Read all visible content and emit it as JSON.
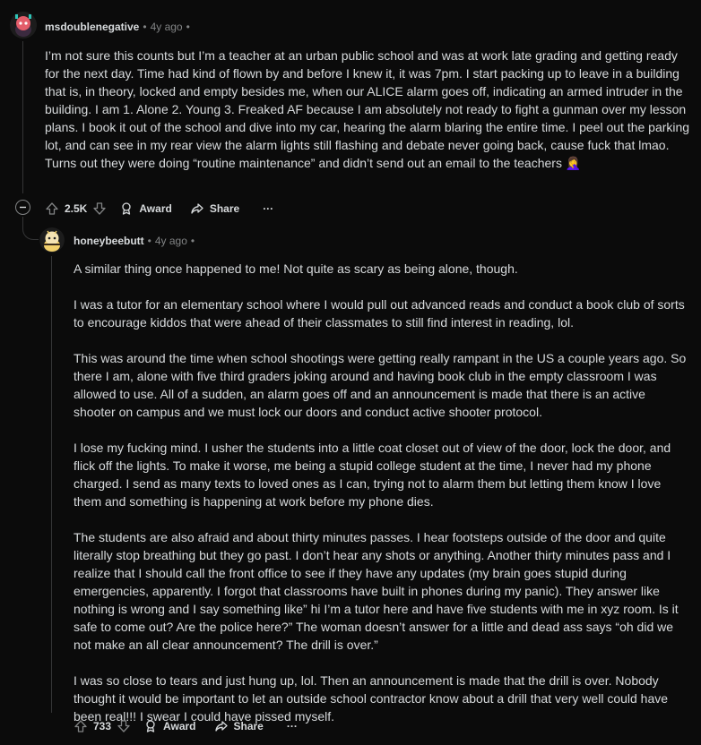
{
  "comments": [
    {
      "author": "msdoublenegative",
      "time": "4y ago",
      "body": [
        "I’m not sure this counts but I’m a teacher at an urban public school and was at work late grading and getting ready for the next day. Time had kind of flown by and before I knew it, it was 7pm. I start packing up to leave in a building that is, in theory, locked and empty besides me, when our ALICE alarm goes off, indicating an armed intruder in the building. I am 1. Alone 2. Young 3. Freaked AF because I am absolutely not ready to fight a gunman over my lesson plans. I book it out of the school and dive into my car, hearing the alarm blaring the entire time. I peel out the parking lot, and can see in my rear view the alarm lights still flashing and debate never going back, cause fuck that lmao. Turns out they were doing “routine maintenance” and didn’t send out an email to the teachers 🤦‍♀️"
      ],
      "votes": "2.5K",
      "award_label": "Award",
      "share_label": "Share",
      "more_label": "···"
    },
    {
      "author": "honeybeebutt",
      "time": "4y ago",
      "body": [
        "A similar thing once happened to me! Not quite as scary as being alone, though.",
        "I was a tutor for an elementary school where I would pull out advanced reads and conduct a book club of sorts to encourage kiddos that were ahead of their classmates to still find interest in reading, lol.",
        "This was around the time when school shootings were getting really rampant in the US a couple years ago. So there I am, alone with five third graders joking around and having book club in the empty classroom I was allowed to use. All of a sudden, an alarm goes off and an announcement is made that there is an active shooter on campus and we must lock our doors and conduct active shooter protocol.",
        "I lose my fucking mind. I usher the students into a little coat closet out of view of the door, lock the door, and flick off the lights. To make it worse, me being a stupid college student at the time, I never had my phone charged. I send as many texts to loved ones as I can, trying not to alarm them but letting them know I love them and something is happening at work before my phone dies.",
        "The students are also afraid and about thirty minutes passes. I hear footsteps outside of the door and quite literally stop breathing but they go past. I don’t hear any shots or anything. Another thirty minutes pass and I realize that I should call the front office to see if they have any updates (my brain goes stupid during emergencies, apparently. I forgot that classrooms have built in phones during my panic). They answer like nothing is wrong and I say something like” hi I’m a tutor here and have five students with me in xyz room. Is it safe to come out? Are the police here?” The woman doesn’t answer for a little and dead ass says “oh did we not make an all clear announcement? The drill is over.”",
        "I was so close to tears and just hung up, lol. Then an announcement is made that the drill is over. Nobody thought it would be important to let an outside school contractor know about a drill that very well could have been real!!! I swear I could have pissed myself."
      ],
      "votes": "733",
      "award_label": "Award",
      "share_label": "Share",
      "more_label": "···"
    }
  ],
  "colors": {
    "background": "#0b0b0b",
    "text": "#d7dadc",
    "muted": "#818384",
    "thread_line": "#343536"
  }
}
